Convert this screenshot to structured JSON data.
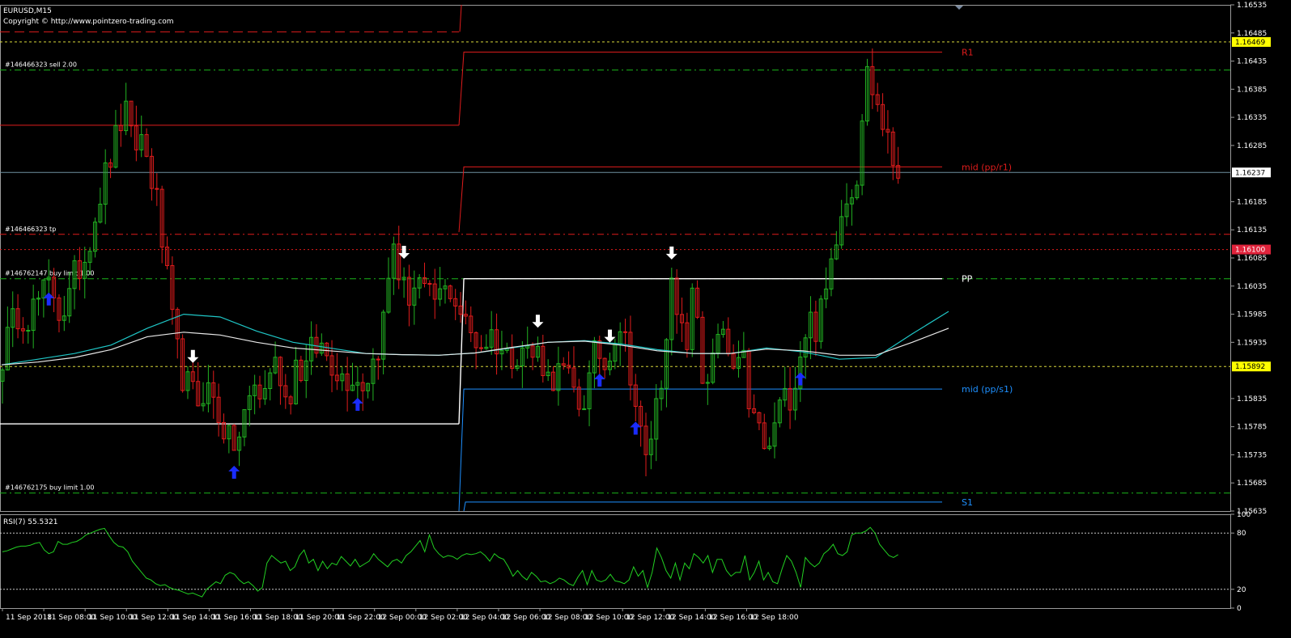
{
  "header": {
    "symbol": "EURUSD,M15",
    "copyright": "Copyright © http://www.pointzero-trading.com"
  },
  "colors": {
    "background": "#000000",
    "frame": "#9a9a9a",
    "bull": "#22b222",
    "bear": "#e01c1c",
    "pivot_red": "#e01c1c",
    "pivot_blue": "#1e90ff",
    "pivot_white": "#ffffff",
    "order_green": "#1bb51b",
    "yellow_level": "#d6d63a",
    "ask_line": "#6f8fa0",
    "ma_cyan": "#1fc7c7",
    "ma_white": "#e8e8e8",
    "rsi": "#22d022",
    "arrow_up": "#1a2cff",
    "arrow_down": "#ffffff",
    "badge_yellow": "#ffff00",
    "badge_red": "#e0233b",
    "badge_white": "#ffffff"
  },
  "price_axis": {
    "min": 1.15635,
    "max": 1.16535,
    "ticks": [
      "1.16535",
      "1.16485",
      "1.16435",
      "1.16385",
      "1.16335",
      "1.16285",
      "1.16185",
      "1.16135",
      "1.16085",
      "1.16035",
      "1.15985",
      "1.15935",
      "1.15835",
      "1.15785",
      "1.15735",
      "1.15685",
      "1.15635"
    ],
    "badges": [
      {
        "label": "1.16469",
        "value": 1.16469,
        "style": "yellow"
      },
      {
        "label": "1.16237",
        "value": 1.16237,
        "style": "white"
      },
      {
        "label": "1.16100",
        "value": 1.161,
        "style": "red"
      },
      {
        "label": "1.15892",
        "value": 1.15892,
        "style": "yellow"
      }
    ]
  },
  "time_axis": {
    "labels": [
      "11 Sep 2018",
      "11 Sep 08:00",
      "11 Sep 10:00",
      "11 Sep 12:00",
      "11 Sep 14:00",
      "11 Sep 16:00",
      "11 Sep 18:00",
      "11 Sep 20:00",
      "11 Sep 22:00",
      "12 Sep 00:00",
      "12 Sep 02:00",
      "12 Sep 04:00",
      "12 Sep 06:00",
      "12 Sep 08:00",
      "12 Sep 10:00",
      "12 Sep 12:00",
      "12 Sep 14:00",
      "12 Sep 16:00",
      "12 Sep 18:00"
    ]
  },
  "orders": [
    {
      "text": "#146466323 sell 2.00",
      "price": 1.16419
    },
    {
      "text": "#146466323 tp",
      "price": 1.16127
    },
    {
      "text": "#146762147 buy limit 1.00",
      "price": 1.16048
    },
    {
      "text": "#146762175 buy limit 1.00",
      "price": 1.15667
    }
  ],
  "pivots": {
    "labels": {
      "r1": "R1",
      "mid_r1": "mid (pp/r1)",
      "pp": "PP",
      "mid_s1": "mid (pp/s1)",
      "s1": "S1"
    },
    "day1": {
      "r1": 1.165,
      "mid_r1": 1.16321,
      "pp": 1.1579
    },
    "day2": {
      "r1": 1.16451,
      "mid_r1": 1.16247,
      "pp": 1.16048,
      "mid_s1": 1.15852,
      "s1": 1.15651
    }
  },
  "levels": {
    "yellow_top": 1.16469,
    "ask": 1.16237,
    "red_dotted": 1.161,
    "yellow_bottom": 1.15892
  },
  "rsi": {
    "title": "RSI(7) 55.5321",
    "ticks": [
      "100",
      "80",
      "20",
      "0"
    ],
    "levels": [
      80,
      20
    ],
    "values": [
      60,
      61,
      63,
      65,
      66,
      66,
      67,
      69,
      70,
      62,
      58,
      60,
      71,
      68,
      68,
      70,
      71,
      74,
      78,
      80,
      82,
      84,
      85,
      77,
      70,
      66,
      65,
      60,
      50,
      44,
      38,
      32,
      30,
      26,
      24,
      25,
      22,
      20,
      19,
      17,
      15,
      16,
      14,
      12,
      20,
      24,
      28,
      26,
      35,
      38,
      36,
      30,
      26,
      28,
      24,
      18,
      22,
      48,
      56,
      52,
      48,
      50,
      40,
      44,
      56,
      62,
      48,
      52,
      40,
      50,
      42,
      48,
      46,
      55,
      50,
      45,
      52,
      44,
      47,
      50,
      58,
      52,
      48,
      44,
      50,
      52,
      48,
      56,
      60,
      66,
      72,
      60,
      78,
      64,
      58,
      54,
      56,
      55,
      52,
      56,
      58,
      57,
      58,
      60,
      56,
      50,
      58,
      54,
      52,
      44,
      34,
      40,
      34,
      30,
      38,
      34,
      28,
      29,
      26,
      28,
      32,
      30,
      26,
      24,
      33,
      40,
      25,
      40,
      30,
      28,
      30,
      36,
      29,
      28,
      26,
      30,
      44,
      34,
      40,
      22,
      38,
      64,
      54,
      40,
      32,
      48,
      30,
      48,
      42,
      58,
      54,
      48,
      56,
      38,
      52,
      52,
      40,
      34,
      38,
      38,
      56,
      30,
      38,
      50,
      30,
      38,
      28,
      26,
      42,
      56,
      50,
      38,
      22,
      54,
      48,
      44,
      48,
      58,
      62,
      68,
      58,
      56,
      60,
      78,
      80,
      80,
      82,
      86,
      80,
      68,
      62,
      56,
      54,
      57
    ]
  },
  "chart_data": {
    "type": "candlestick",
    "symbol": "EURUSD",
    "timeframe": "M15",
    "ylim": [
      1.15635,
      1.16535
    ],
    "ohlc_path": [
      1.1591,
      1.1596,
      1.1599,
      1.1598,
      1.16,
      1.1602,
      1.1604,
      1.1599,
      1.16,
      1.1606,
      1.1608,
      1.1614,
      1.162,
      1.1625,
      1.163,
      1.1635,
      1.1628,
      1.163,
      1.1625,
      1.1618,
      1.1607,
      1.1595,
      1.1588,
      1.1585,
      1.1583,
      1.1586,
      1.1583,
      1.1579,
      1.1575,
      1.1576,
      1.1582,
      1.1586,
      1.1583,
      1.159,
      1.1589,
      1.1582,
      1.159,
      1.1588,
      1.1592,
      1.1593,
      1.1591,
      1.1589,
      1.1587,
      1.1588,
      1.1586,
      1.1588,
      1.1592,
      1.1599,
      1.1612,
      1.1603,
      1.1602,
      1.1605,
      1.1601,
      1.1601,
      1.1602,
      1.1603,
      1.16,
      1.1596,
      1.1594,
      1.1593,
      1.1595,
      1.1593,
      1.1591,
      1.1592,
      1.1593,
      1.1591,
      1.1592,
      1.1587,
      1.1588,
      1.1588,
      1.1585,
      1.1582,
      1.1586,
      1.1593,
      1.1589,
      1.1595,
      1.1597,
      1.159,
      1.158,
      1.1572,
      1.158,
      1.1588,
      1.1604,
      1.1596,
      1.1593,
      1.1604,
      1.1587,
      1.1588,
      1.1595,
      1.1592,
      1.1587,
      1.159,
      1.158,
      1.1578,
      1.1572,
      1.1581,
      1.1583,
      1.1585,
      1.1592,
      1.1598,
      1.1596,
      1.1601,
      1.161,
      1.1618,
      1.162,
      1.1624,
      1.1642,
      1.1638,
      1.1633,
      1.1627,
      1.1624
    ],
    "moving_averages": [
      {
        "color": "cyan",
        "values": [
          1.15895,
          1.15905,
          1.15915,
          1.1593,
          1.1596,
          1.15985,
          1.1598,
          1.15955,
          1.15935,
          1.15925,
          1.15915,
          1.15913,
          1.15912,
          1.15916,
          1.15925,
          1.15935,
          1.15938,
          1.15932,
          1.15922,
          1.15915,
          1.15915,
          1.15925,
          1.15918,
          1.15905,
          1.15908,
          1.1595,
          1.1599
        ]
      },
      {
        "color": "white",
        "values": [
          1.15895,
          1.159,
          1.15908,
          1.15922,
          1.15945,
          1.15953,
          1.15948,
          1.15935,
          1.15925,
          1.1592,
          1.15915,
          1.15913,
          1.15912,
          1.15916,
          1.15926,
          1.15935,
          1.15937,
          1.1593,
          1.1592,
          1.15915,
          1.15915,
          1.15923,
          1.1592,
          1.15912,
          1.15912,
          1.15935,
          1.1596
        ]
      }
    ],
    "signals": [
      {
        "dir": "up",
        "bar": 9
      },
      {
        "dir": "down",
        "bar": 37
      },
      {
        "dir": "up",
        "bar": 45
      },
      {
        "dir": "up",
        "bar": 69
      },
      {
        "dir": "down",
        "bar": 78
      },
      {
        "dir": "down",
        "bar": 104
      },
      {
        "dir": "up",
        "bar": 116
      },
      {
        "dir": "down",
        "bar": 118
      },
      {
        "dir": "up",
        "bar": 123
      },
      {
        "dir": "down",
        "bar": 130
      },
      {
        "dir": "up",
        "bar": 155
      }
    ]
  }
}
